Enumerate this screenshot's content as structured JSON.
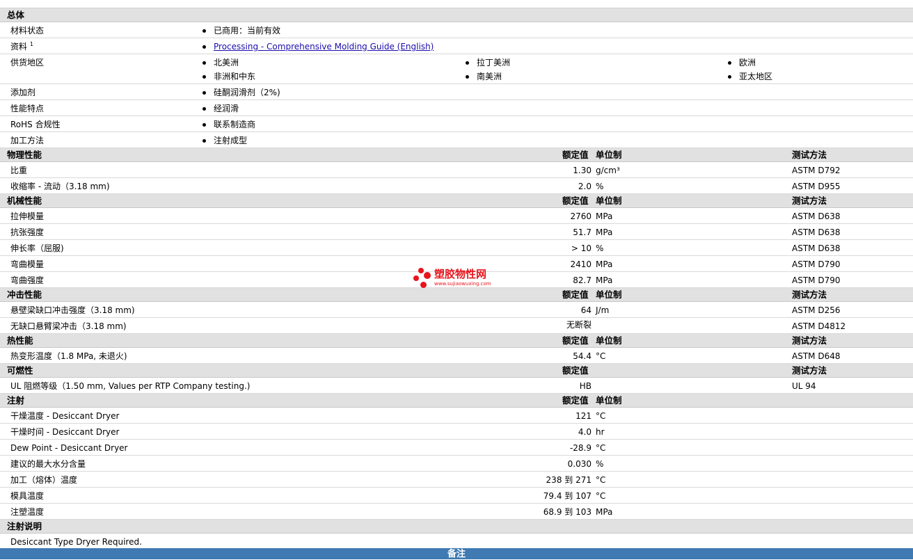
{
  "general": {
    "header": "总体",
    "rows": {
      "status": {
        "label": "材料状态",
        "value": "已商用：当前有效"
      },
      "docs": {
        "label": "资料",
        "sup": "1",
        "link": "Processing - Comprehensive Molding Guide (English)"
      },
      "regions": {
        "label": "供货地区",
        "items": [
          "北美洲",
          "拉丁美洲",
          "欧洲",
          "非洲和中东",
          "南美洲",
          "亚太地区"
        ]
      },
      "additive": {
        "label": "添加剂",
        "value": "硅酮润滑剂（2%)"
      },
      "features": {
        "label": "性能特点",
        "value": "经润滑"
      },
      "rohs": {
        "label": "RoHS 合规性",
        "value": "联系制造商"
      },
      "method": {
        "label": "加工方法",
        "value": "注射成型"
      }
    }
  },
  "columns": {
    "value": "额定值",
    "unit": "单位制",
    "test": "测试方法"
  },
  "physical": {
    "header": "物理性能",
    "rows": [
      {
        "label": "比重",
        "value": "1.30",
        "unit": "g/cm³",
        "test": "ASTM D792"
      },
      {
        "label": "收缩率 - 流动（3.18 mm)",
        "value": "2.0",
        "unit": "%",
        "test": "ASTM D955"
      }
    ]
  },
  "mechanical": {
    "header": "机械性能",
    "rows": [
      {
        "label": "拉伸模量",
        "value": "2760",
        "unit": "MPa",
        "test": "ASTM D638"
      },
      {
        "label": "抗张强度",
        "value": "51.7",
        "unit": "MPa",
        "test": "ASTM D638"
      },
      {
        "label": "伸长率（屈服)",
        "value": "> 10",
        "unit": "%",
        "test": "ASTM D638"
      },
      {
        "label": "弯曲模量",
        "value": "2410",
        "unit": "MPa",
        "test": "ASTM D790"
      },
      {
        "label": "弯曲强度",
        "value": "82.7",
        "unit": "MPa",
        "test": "ASTM D790"
      }
    ]
  },
  "impact": {
    "header": "冲击性能",
    "rows": [
      {
        "label": "悬壁梁缺口冲击强度（3.18 mm)",
        "value": "64",
        "unit": "J/m",
        "test": "ASTM D256"
      },
      {
        "label": "无缺口悬臂梁冲击（3.18 mm)",
        "value": "无断裂",
        "unit": "",
        "test": "ASTM D4812"
      }
    ]
  },
  "thermal": {
    "header": "热性能",
    "rows": [
      {
        "label": "热变形温度（1.8 MPa, 未退火)",
        "value": "54.4",
        "unit": "°C",
        "test": "ASTM D648"
      }
    ]
  },
  "flammability": {
    "header": "可燃性",
    "rows": [
      {
        "label": "UL 阻燃等级（1.50 mm, Values per RTP Company testing.)",
        "value": "HB",
        "unit": "",
        "test": "UL 94"
      }
    ]
  },
  "injection": {
    "header": "注射",
    "rows": [
      {
        "label": "干燥温度 - Desiccant Dryer",
        "value": "121",
        "unit": "°C"
      },
      {
        "label": "干燥时间 - Desiccant Dryer",
        "value": "4.0",
        "unit": "hr"
      },
      {
        "label": "Dew Point - Desiccant Dryer",
        "value": "-28.9",
        "unit": "°C"
      },
      {
        "label": "建议的最大水分含量",
        "value": "0.030",
        "unit": "%"
      },
      {
        "label": "加工（熔体）温度",
        "value": "238 到 271",
        "unit": "°C"
      },
      {
        "label": "模具温度",
        "value": "79.4 到 107",
        "unit": "°C"
      },
      {
        "label": "注塑温度",
        "value": "68.9 到 103",
        "unit": "MPa"
      }
    ]
  },
  "injection_notes": {
    "header": "注射说明",
    "text": "Desiccant Type Dryer Required."
  },
  "footer": {
    "label": "备注"
  },
  "watermark": {
    "title": "塑胶物性网",
    "url": "www.sujiaowuxing.com",
    "color": "#e8141c"
  }
}
